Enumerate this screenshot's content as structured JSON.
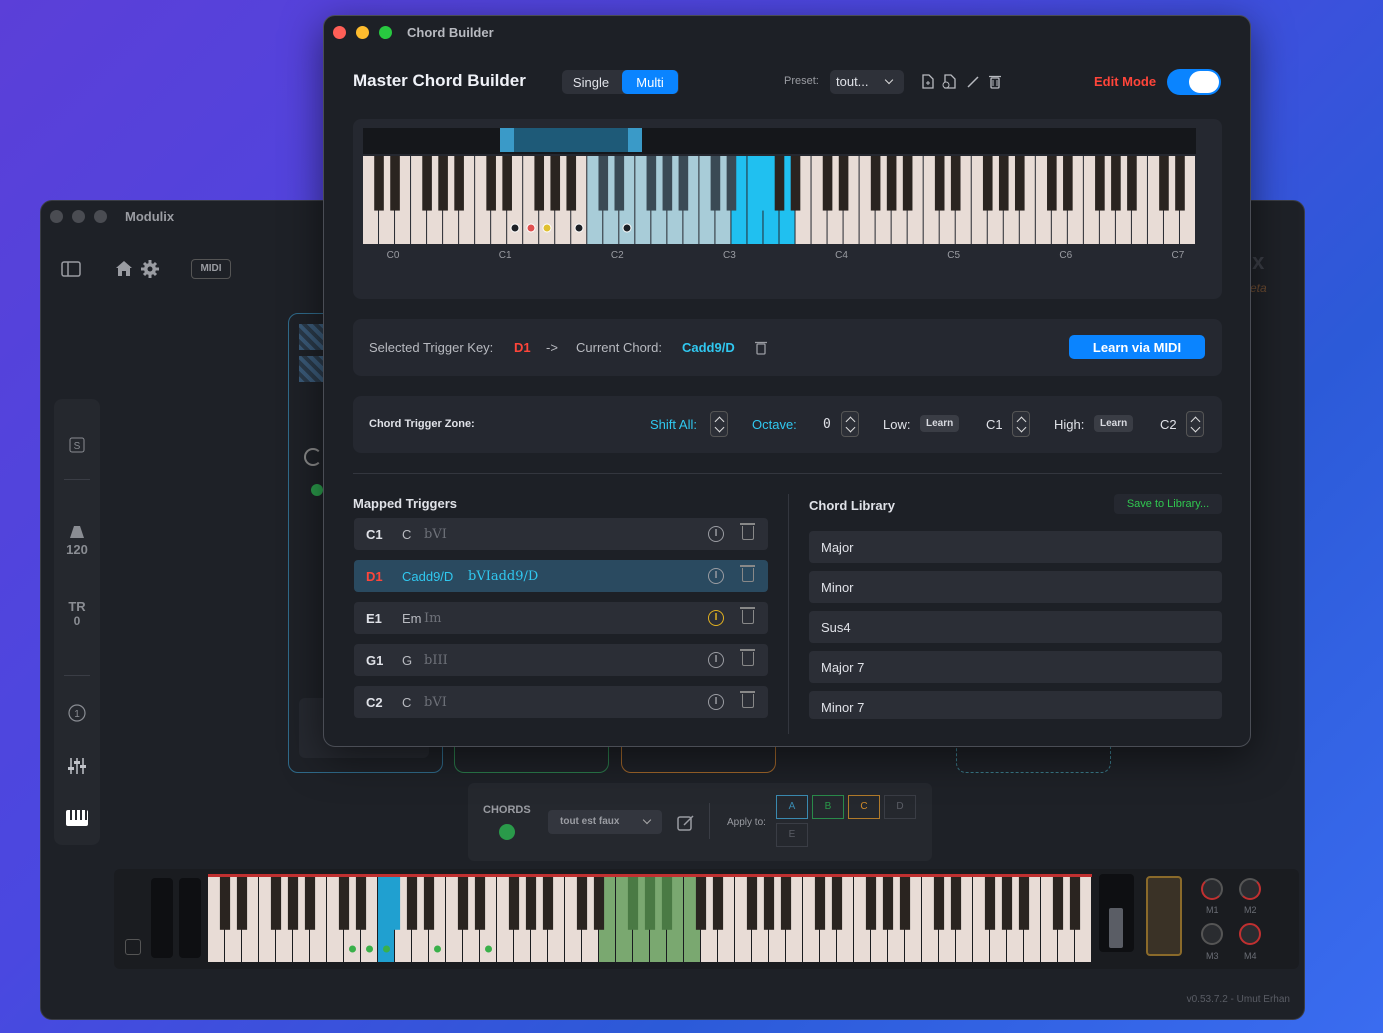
{
  "back_window": {
    "title": "Modulix",
    "midi_label": "MIDI",
    "tempo": "120",
    "tr_label": "TR",
    "tr_value": "0",
    "version": "v0.53.7.2 - Umut Erhan",
    "logo_fragment": "ix",
    "beta_fragment": "eta",
    "chords_bar": {
      "label": "CHORDS",
      "preset": "tout est faux",
      "apply_label": "Apply to:",
      "targets": [
        "A",
        "B",
        "C",
        "D",
        "E"
      ]
    },
    "macros": [
      "M1",
      "M2",
      "M3",
      "M4"
    ]
  },
  "window": {
    "title": "Chord Builder"
  },
  "header": {
    "title": "Master Chord Builder",
    "mode_single": "Single",
    "mode_multi": "Multi",
    "preset_label": "Preset:",
    "preset_value": "tout...",
    "edit_mode": "Edit Mode"
  },
  "keyboard": {
    "octave_labels": [
      "C0",
      "C1",
      "C2",
      "C3",
      "C4",
      "C5",
      "C6",
      "C7"
    ]
  },
  "trigger": {
    "selected_label": "Selected Trigger Key:",
    "selected_key": "D1",
    "arrow": "->",
    "chord_label": "Current Chord:",
    "chord": "Cadd9/D",
    "learn_midi": "Learn via MIDI"
  },
  "zone": {
    "label": "Chord Trigger Zone:",
    "shift_label": "Shift All:",
    "octave_label": "Octave:",
    "octave_value": "0",
    "low_label": "Low:",
    "low_value": "C1",
    "high_label": "High:",
    "high_value": "C2",
    "learn": "Learn"
  },
  "mapped": {
    "title": "Mapped Triggers",
    "info": "I",
    "rows": [
      {
        "key": "C1",
        "chord": "C",
        "roman": "bVI"
      },
      {
        "key": "D1",
        "chord": "Cadd9/D",
        "roman": "bVIadd9/D"
      },
      {
        "key": "E1",
        "chord": "Em",
        "roman": "Im"
      },
      {
        "key": "G1",
        "chord": "G",
        "roman": "bIII"
      },
      {
        "key": "C2",
        "chord": "C",
        "roman": "bVI"
      }
    ]
  },
  "library": {
    "title": "Chord Library",
    "save": "Save to Library...",
    "items": [
      "Major",
      "Minor",
      "Sus4",
      "Major 7",
      "Minor 7"
    ]
  },
  "colors": {
    "accent": "#0a84ff",
    "red": "#ff453a",
    "cyan": "#30c8f0"
  }
}
